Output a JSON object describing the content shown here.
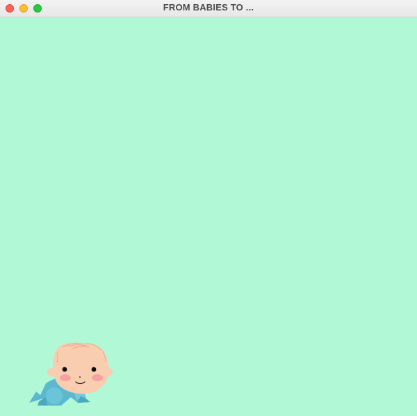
{
  "window": {
    "title": "FROM BABIES TO ...",
    "controls": [
      "close",
      "minimize",
      "zoom"
    ]
  },
  "game": {
    "background_color": "#b1f8d6",
    "player": {
      "sprite": "crawling-baby",
      "skin_color": "#f8cdb0",
      "cheek_color": "#f6a3a0",
      "outfit_color": "#5bb8cf"
    }
  }
}
